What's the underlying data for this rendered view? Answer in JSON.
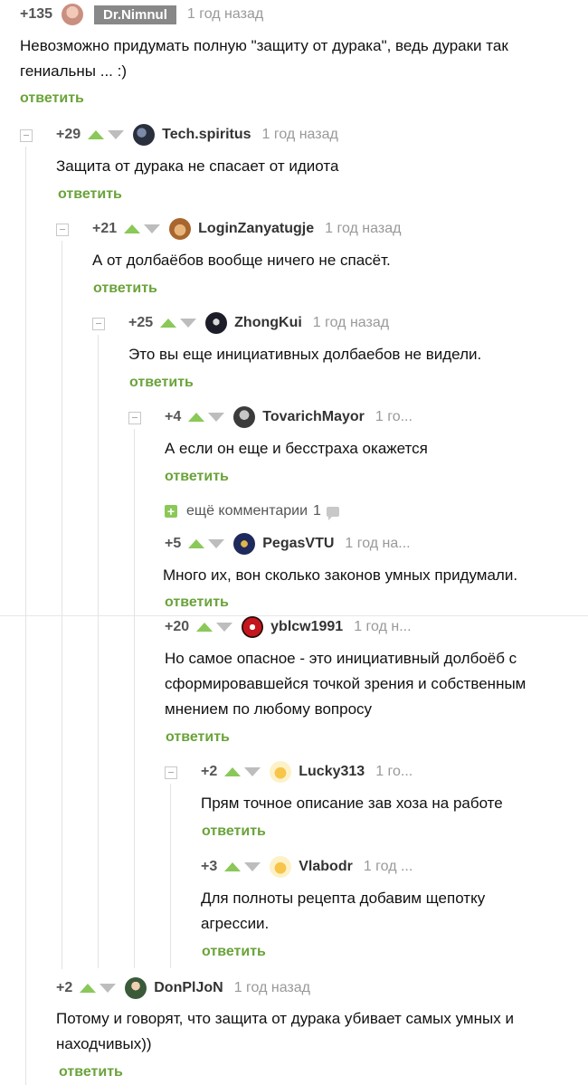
{
  "comments": [
    {
      "id": "c1",
      "rating": "+135",
      "user": "Dr.Nimnul",
      "time": "1 год назад",
      "text": [
        "Невозможно придумать полную \"защиту от дурака\", ведь дураки так",
        "гениальны ... :)"
      ],
      "reply": "ответить"
    },
    {
      "id": "c2",
      "rating": "+29",
      "user": "Tech.spiritus",
      "time": "1 год назад",
      "text": [
        "Защита от дурака не спасает от идиота"
      ],
      "reply": "ответить"
    },
    {
      "id": "c3",
      "rating": "+21",
      "user": "LoginZanyatugje",
      "time": "1 год назад",
      "text": [
        "А от долбаёбов вообще ничего не спасёт."
      ],
      "reply": "ответить"
    },
    {
      "id": "c4",
      "rating": "+25",
      "user": "ZhongKui",
      "time": "1 год назад",
      "text": [
        "Это вы еще инициативных долбаебов не видели."
      ],
      "reply": "ответить"
    },
    {
      "id": "c5",
      "rating": "+4",
      "user": "TovarichMayor",
      "time": "1 го...",
      "text": [
        "А если он еще и бесстраха окажется"
      ],
      "reply": "ответить"
    },
    {
      "id": "c6",
      "rating": "+5",
      "user": "PegasVTU",
      "time": "1 год на...",
      "text": [
        "Много их, вон сколько законов умных придумали."
      ],
      "reply": "ответить"
    },
    {
      "id": "c7",
      "rating": "+20",
      "user": "yblcw1991",
      "time": "1 год н...",
      "text": [
        "Но самое опасное - это инициативный долбоёб с",
        "сформировавшейся точкой зрения и собственным",
        "мнением по любому вопросу"
      ],
      "reply": "ответить"
    },
    {
      "id": "c8",
      "rating": "+2",
      "user": "Lucky313",
      "time": "1 го...",
      "text": [
        "Прям точное описание зав хоза на работе"
      ],
      "reply": "ответить"
    },
    {
      "id": "c9",
      "rating": "+3",
      "user": "Vlabodr",
      "time": "1 год ...",
      "text": [
        "Для полноты рецепта добавим щепотку",
        "агрессии."
      ],
      "reply": "ответить"
    },
    {
      "id": "c10",
      "rating": "+2",
      "user": "DonPlJoN",
      "time": "1 год назад",
      "text": [
        "Потому и говорят, что защита от дурака убивает самых умных и",
        "находчивых))"
      ],
      "reply": "ответить"
    }
  ],
  "more_comments": {
    "label": "ещё комментарии",
    "count": "1"
  },
  "colors": {
    "accent": "#8ac858",
    "reply": "#6aa33a",
    "muted": "#999999",
    "badge": "#888888"
  }
}
